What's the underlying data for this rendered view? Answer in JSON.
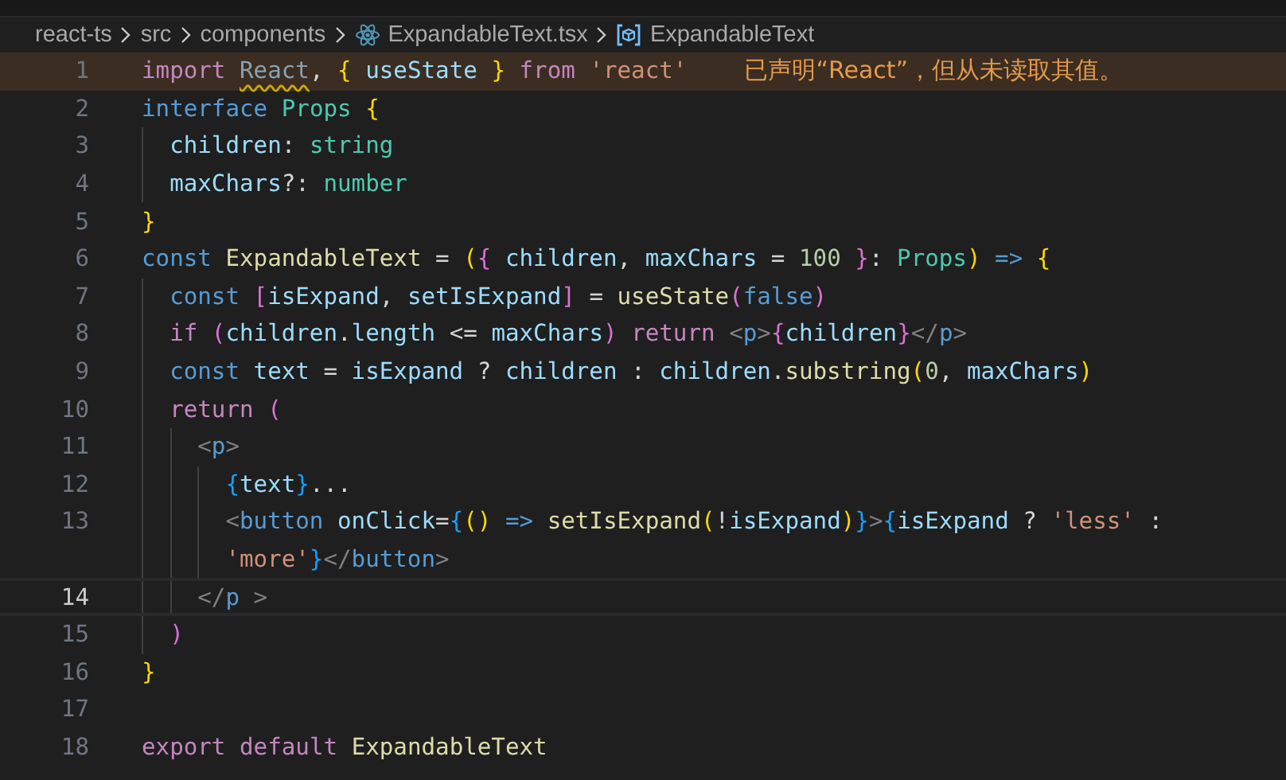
{
  "breadcrumbs": [
    {
      "kind": "folder",
      "text": "react-ts"
    },
    {
      "kind": "folder",
      "text": "src"
    },
    {
      "kind": "folder",
      "text": "components"
    },
    {
      "kind": "file",
      "text": "ExpandableText.tsx"
    },
    {
      "kind": "symbol",
      "text": "ExpandableText"
    }
  ],
  "lines": [
    {
      "number": "1",
      "current": false,
      "warning": "已声明“React”，但从未读取其值。",
      "tokens": [
        {
          "kind": "k",
          "text": "import "
        },
        {
          "kind": "u",
          "text": "React"
        },
        {
          "kind": "p",
          "text": ", "
        },
        {
          "kind": "b1",
          "text": "{ "
        },
        {
          "kind": "v",
          "text": "useState "
        },
        {
          "kind": "b1",
          "text": "} "
        },
        {
          "kind": "k",
          "text": "from "
        },
        {
          "kind": "str",
          "text": "'react'"
        }
      ]
    },
    {
      "number": "2",
      "current": false,
      "tokens": [
        {
          "kind": "s",
          "text": "interface "
        },
        {
          "kind": "t",
          "text": "Props "
        },
        {
          "kind": "b1",
          "text": "{"
        }
      ]
    },
    {
      "number": "3",
      "current": false,
      "tokens": [
        {
          "kind": "v",
          "text": "  children"
        },
        {
          "kind": "p",
          "text": ": "
        },
        {
          "kind": "t",
          "text": "string"
        }
      ]
    },
    {
      "number": "4",
      "current": false,
      "tokens": [
        {
          "kind": "v",
          "text": "  maxChars"
        },
        {
          "kind": "p",
          "text": "?: "
        },
        {
          "kind": "t",
          "text": "number"
        }
      ]
    },
    {
      "number": "5",
      "current": false,
      "tokens": [
        {
          "kind": "b1",
          "text": "}"
        }
      ]
    },
    {
      "number": "6",
      "current": false,
      "tokens": [
        {
          "kind": "s",
          "text": "const "
        },
        {
          "kind": "f",
          "text": "ExpandableText "
        },
        {
          "kind": "p",
          "text": "= "
        },
        {
          "kind": "b1",
          "text": "("
        },
        {
          "kind": "b2",
          "text": "{ "
        },
        {
          "kind": "v",
          "text": "children"
        },
        {
          "kind": "p",
          "text": ", "
        },
        {
          "kind": "v",
          "text": "maxChars "
        },
        {
          "kind": "p",
          "text": "= "
        },
        {
          "kind": "n",
          "text": "100 "
        },
        {
          "kind": "b2",
          "text": "}"
        },
        {
          "kind": "p",
          "text": ": "
        },
        {
          "kind": "t",
          "text": "Props"
        },
        {
          "kind": "b1",
          "text": ") "
        },
        {
          "kind": "s",
          "text": "=> "
        },
        {
          "kind": "b1",
          "text": "{"
        }
      ]
    },
    {
      "number": "7",
      "current": false,
      "tokens": [
        {
          "kind": "s",
          "text": "  const "
        },
        {
          "kind": "b2",
          "text": "["
        },
        {
          "kind": "v",
          "text": "isExpand"
        },
        {
          "kind": "p",
          "text": ", "
        },
        {
          "kind": "v",
          "text": "setIsExpand"
        },
        {
          "kind": "b2",
          "text": "] "
        },
        {
          "kind": "p",
          "text": "= "
        },
        {
          "kind": "f",
          "text": "useState"
        },
        {
          "kind": "b2",
          "text": "("
        },
        {
          "kind": "s",
          "text": "false"
        },
        {
          "kind": "b2",
          "text": ")"
        }
      ]
    },
    {
      "number": "8",
      "current": false,
      "tokens": [
        {
          "kind": "k",
          "text": "  if "
        },
        {
          "kind": "b2",
          "text": "("
        },
        {
          "kind": "v",
          "text": "children"
        },
        {
          "kind": "p",
          "text": "."
        },
        {
          "kind": "v",
          "text": "length "
        },
        {
          "kind": "p",
          "text": "<= "
        },
        {
          "kind": "v",
          "text": "maxChars"
        },
        {
          "kind": "b2",
          "text": ") "
        },
        {
          "kind": "k",
          "text": "return "
        },
        {
          "kind": "tp",
          "text": "<"
        },
        {
          "kind": "tg",
          "text": "p"
        },
        {
          "kind": "tp",
          "text": ">"
        },
        {
          "kind": "b2",
          "text": "{"
        },
        {
          "kind": "v",
          "text": "children"
        },
        {
          "kind": "b2",
          "text": "}"
        },
        {
          "kind": "tp",
          "text": "</"
        },
        {
          "kind": "tg",
          "text": "p"
        },
        {
          "kind": "tp",
          "text": ">"
        }
      ]
    },
    {
      "number": "9",
      "current": false,
      "tokens": [
        {
          "kind": "s",
          "text": "  const "
        },
        {
          "kind": "v",
          "text": "text "
        },
        {
          "kind": "p",
          "text": "= "
        },
        {
          "kind": "v",
          "text": "isExpand "
        },
        {
          "kind": "p",
          "text": "? "
        },
        {
          "kind": "v",
          "text": "children "
        },
        {
          "kind": "p",
          "text": ": "
        },
        {
          "kind": "v",
          "text": "children"
        },
        {
          "kind": "p",
          "text": "."
        },
        {
          "kind": "f",
          "text": "substring"
        },
        {
          "kind": "b1",
          "text": "("
        },
        {
          "kind": "n",
          "text": "0"
        },
        {
          "kind": "p",
          "text": ", "
        },
        {
          "kind": "v",
          "text": "maxChars"
        },
        {
          "kind": "b1",
          "text": ")"
        }
      ]
    },
    {
      "number": "10",
      "current": false,
      "tokens": [
        {
          "kind": "k",
          "text": "  return "
        },
        {
          "kind": "b2",
          "text": "("
        }
      ]
    },
    {
      "number": "11",
      "current": false,
      "tokens": [
        {
          "kind": "tp",
          "text": "    <"
        },
        {
          "kind": "tg",
          "text": "p"
        },
        {
          "kind": "tp",
          "text": ">"
        }
      ]
    },
    {
      "number": "12",
      "current": false,
      "tokens": [
        {
          "kind": "b3",
          "text": "      {"
        },
        {
          "kind": "v",
          "text": "text"
        },
        {
          "kind": "b3",
          "text": "}"
        },
        {
          "kind": "p",
          "text": "..."
        }
      ]
    },
    {
      "number": "13",
      "current": false,
      "tokens": [
        {
          "kind": "tp",
          "text": "      <"
        },
        {
          "kind": "tg",
          "text": "button "
        },
        {
          "kind": "v",
          "text": "onClick"
        },
        {
          "kind": "p",
          "text": "="
        },
        {
          "kind": "b3",
          "text": "{"
        },
        {
          "kind": "b1",
          "text": "() "
        },
        {
          "kind": "s",
          "text": "=> "
        },
        {
          "kind": "f",
          "text": "setIsExpand"
        },
        {
          "kind": "b1",
          "text": "("
        },
        {
          "kind": "p",
          "text": "!"
        },
        {
          "kind": "v",
          "text": "isExpand"
        },
        {
          "kind": "b1",
          "text": ")"
        },
        {
          "kind": "b3",
          "text": "}"
        },
        {
          "kind": "tp",
          "text": ">"
        },
        {
          "kind": "b3",
          "text": "{"
        },
        {
          "kind": "v",
          "text": "isExpand "
        },
        {
          "kind": "p",
          "text": "? "
        },
        {
          "kind": "str",
          "text": "'less' "
        },
        {
          "kind": "p",
          "text": ":"
        }
      ],
      "wrap": [
        {
          "kind": "str",
          "text": "'more'"
        },
        {
          "kind": "b3",
          "text": "}"
        },
        {
          "kind": "tp",
          "text": "</"
        },
        {
          "kind": "tg",
          "text": "button"
        },
        {
          "kind": "tp",
          "text": ">"
        }
      ]
    },
    {
      "number": "14",
      "current": true,
      "tokens": [
        {
          "kind": "tp",
          "text": "    </"
        },
        {
          "kind": "tg",
          "text": "p "
        },
        {
          "kind": "tp",
          "text": ">"
        }
      ]
    },
    {
      "number": "15",
      "current": false,
      "tokens": [
        {
          "kind": "b2",
          "text": "  )"
        }
      ]
    },
    {
      "number": "16",
      "current": false,
      "tokens": [
        {
          "kind": "b1",
          "text": "}"
        }
      ]
    },
    {
      "number": "17",
      "current": false
    },
    {
      "number": "18",
      "current": false,
      "tokens": [
        {
          "kind": "k",
          "text": "export "
        },
        {
          "kind": "k",
          "text": "default "
        },
        {
          "kind": "f",
          "text": "ExpandableText"
        }
      ]
    }
  ]
}
